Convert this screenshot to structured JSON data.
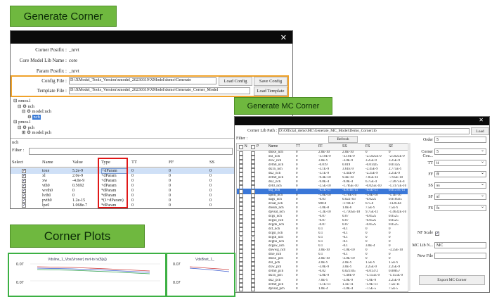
{
  "labels": {
    "generate_corner": "Generate Corner",
    "generate_mc_corner": "Generate MC Corner",
    "corner_plots": "Corner Plots"
  },
  "corner_window": {
    "close": "✕",
    "fields": [
      {
        "label": "Corner Postfix :",
        "value": "_nrvt"
      },
      {
        "label": "Core Model Lib Name :",
        "value": "core"
      },
      {
        "label": "Param Postfix :",
        "value": "_nrvt"
      }
    ],
    "config_label": "Config File :",
    "config_value": "D:\\XModel_Tools_Version\\xmodel_20230319\\XModel\\demo\\Generate",
    "load_config": "Load Config",
    "save_config": "Save Config",
    "template_label": "Template File :",
    "template_value": "D:\\XModel_Tools_Version\\xmodel_20230319\\XModel\\demo\\Generate_Corner_Model",
    "load_template": "Load Template",
    "tree": [
      "nmos.l",
      "nch",
      "model:nch",
      "nch",
      "pmos.l",
      "pch",
      "model:pch"
    ],
    "section": "nch",
    "filter_label": "Filter :",
    "columns": [
      "Select",
      "Name",
      "Value",
      "Type",
      "TT",
      "FF",
      "SS",
      "FS"
    ],
    "rows": [
      {
        "name": "toxe",
        "value": "5.2e-9",
        "type": "+dParam",
        "tt": "0",
        "ff": "0",
        "ss": "0",
        "fs": "0",
        "sel": true
      },
      {
        "name": "xl",
        "value": "2.0e-9",
        "type": "+dParam",
        "tt": "0",
        "ff": "0",
        "ss": "0",
        "fs": "0",
        "sel": true
      },
      {
        "name": "xw",
        "value": "-4.0e-9",
        "type": "+dParam",
        "tt": "0",
        "ff": "0",
        "ss": "0",
        "fs": "0",
        "sel": true
      },
      {
        "name": "vth0",
        "value": "0.5692",
        "type": "+dParam",
        "tt": "0",
        "ff": "0",
        "ss": "0",
        "fs": "0",
        "sel": true
      },
      {
        "name": "wvth0",
        "value": "0",
        "type": "*dParam",
        "tt": "0",
        "ff": "0",
        "ss": "0",
        "fs": "0",
        "sel": true
      },
      {
        "name": "lvth0",
        "value": "0",
        "type": "*dParam",
        "tt": "0",
        "ff": "0",
        "ss": "0",
        "fs": "0",
        "sel": true
      },
      {
        "name": "pvth0",
        "value": "1.2e-15",
        "type": "*(1+dParam)",
        "tt": "0",
        "ff": "0",
        "ss": "0",
        "fs": "0",
        "sel": true
      },
      {
        "name": "lpe0",
        "value": "1.068e-7",
        "type": "*dParam",
        "tt": "0",
        "ff": "0",
        "ss": "0",
        "fs": "0",
        "sel": true
      }
    ]
  },
  "mc_window": {
    "close": "✕",
    "path_label": "Corner Lib Path :",
    "path_value": "D:\\Official_demo\\MC\\Generate_MC_Model\\Demo_Corner.lib",
    "load": "Load",
    "filter_label": "Filter :",
    "refresh": "Refresh",
    "columns": [
      "N",
      "P",
      "Name",
      "TT",
      "FF",
      "SS",
      "FS",
      "SF"
    ],
    "rows": [
      [
        "dtoxe_nch",
        "0",
        "2.0E-10",
        "2.0E-10",
        "0",
        "0"
      ],
      [
        "dxl_nch",
        "0",
        "-3.19E-9",
        "-3.19E-9",
        "-2.5925E-9",
        "-2.5925E-9"
      ],
      [
        "dxw_nch",
        "0",
        "3.0E-9",
        "-3.0E-9",
        "3.25E-9",
        "3.25E-9"
      ],
      [
        "dvth0_nch",
        "0",
        "-0.019",
        "0.019",
        "-0.01425",
        "0.01425"
      ],
      [
        "dk1n_nch",
        "0",
        "-3.1E-9",
        "3.61E-9",
        "-2.45E-9",
        "2.775E-9"
      ],
      [
        "dk2_nch",
        "0",
        "-3.1E-9",
        "-3.44E-9",
        "-2.25E-9",
        "2.25E-9"
      ],
      [
        "dvth0_nch",
        "0",
        "-9.4E-10",
        "9.4E-10",
        "7.05E-10",
        "-7.05E-10"
      ],
      [
        "dk2_nch",
        "0",
        "-9.0E-4",
        "-9.0E-4",
        "6.75E-4",
        "-7.2075E-4"
      ],
      [
        "dvt0_nch",
        "0",
        "-2.5E-10",
        "-1.785E-10",
        "-0.025E-10",
        "-1.3175E-10"
      ],
      [
        "dxj_nch",
        "0",
        "-6.1E-11",
        "-4.011E-11",
        "-4.5E-11",
        "0.0137E-11"
      ],
      [
        "dpoli_nch",
        "0",
        "-1.0E-10",
        "-1.76E-10",
        "-1.0E-10",
        "-1.1E-10"
      ],
      [
        "dags_nch",
        "0",
        "-0.03",
        "0.022703",
        "-0.0225",
        "0.016925"
      ],
      [
        "dvsat_nch",
        "0",
        "900.0",
        "-1794.17",
        "675.0",
        "-1126.64"
      ],
      [
        "dnsub_nch",
        "0",
        "-1.0E-8",
        "1.0E-8",
        "7.5E-9",
        "7.5E-9"
      ],
      [
        "dpvsat_nch",
        "0",
        "-1.3E-10",
        "-1.7305E-10",
        "9.75E-11",
        "-1.4632E-10"
      ],
      [
        "dcgs_nch",
        "0",
        "-0.07",
        "0.07",
        "-0.0525",
        "0.0525"
      ],
      [
        "dcgso_nch",
        "0",
        "-0.07",
        "0.07",
        "-0.0525",
        "0.0525"
      ],
      [
        "dcgdo_nch",
        "0",
        "-0.07",
        "0.07",
        "-0.0525",
        "0.0525"
      ],
      [
        "dcf_nch",
        "0",
        "0.1",
        "-0.1",
        "0",
        "0"
      ],
      [
        "dcgsl_nch",
        "0",
        "0.1",
        "-0.1",
        "0",
        "0"
      ],
      [
        "dcgdl_nch",
        "0",
        "0.1",
        "-0.1",
        "0",
        "0"
      ],
      [
        "dcgbo_nch",
        "0",
        "0.1",
        "-0.1",
        "0",
        "0"
      ],
      [
        "dcgsw_nch",
        "0",
        "0.1",
        "-0.1",
        "3.0E-4",
        "0"
      ],
      [
        "dnwwg_nch",
        "0",
        "3.0E-10",
        "-1.0E-10",
        "0",
        "-3.25E-10"
      ],
      [
        "dtxe_nch",
        "0",
        "0.1",
        "-0.1",
        "0",
        "0"
      ],
      [
        "dtoxe_pch",
        "0",
        "2.0E-10",
        "-2.0E-10",
        "0",
        "0"
      ],
      [
        "dxl_pch",
        "0",
        "2.0E-9",
        "2.0E-9",
        "1.5E-9",
        "1.5E-9"
      ],
      [
        "dxw_pch",
        "0",
        "-3.0E-9",
        "3.0E-9",
        "2.25E-9",
        "2.25E-9"
      ],
      [
        "dvth0_pch",
        "0",
        "-0.02",
        "0.021105",
        "-0.01372",
        "0.00857"
      ],
      [
        "dk1n_pch",
        "0",
        "-2.0E-9",
        "-1.40E-9",
        "-1.155E-9",
        "-1.155E-9"
      ],
      [
        "dk2_pch",
        "0",
        "7.0E-9",
        "-2.0E-9",
        "-1.0E-9",
        "2.25E-9"
      ],
      [
        "dvth0_pch",
        "0",
        "-1.1E-11",
        "1.1E-11",
        "-1.9E-11",
        "7.5E-11"
      ],
      [
        "dpvsat_pch",
        "0",
        "1.0E-4",
        "-1.0E-4",
        "-7.5E-5",
        "7.5E-5"
      ]
    ],
    "side_fields": [
      {
        "label": "Order",
        "value": "5"
      },
      {
        "label": "Corner Cou...",
        "value": "5"
      },
      {
        "label": "TT",
        "value": "tt"
      },
      {
        "label": "FF",
        "value": "ff"
      },
      {
        "label": "SS",
        "value": "ss"
      },
      {
        "label": "SF",
        "value": "sf"
      },
      {
        "label": "FS",
        "value": "fs"
      }
    ],
    "nf_scale_label": "NF Scale",
    "mc_lib_label": "MC Lib N...",
    "mc_lib_value": "MC",
    "new_file_label": "New File",
    "export": "Export MC Corner"
  },
  "plots": [
    {
      "title": "Vdsline_1_Vbs(Vroner) mvt-to tv(5[a])",
      "ylabel": "0.07",
      "ylabel2": "0.07"
    },
    {
      "title": "VdsBnxt_1_",
      "ylabel": "0.07",
      "ylabel2": "0.07"
    }
  ]
}
